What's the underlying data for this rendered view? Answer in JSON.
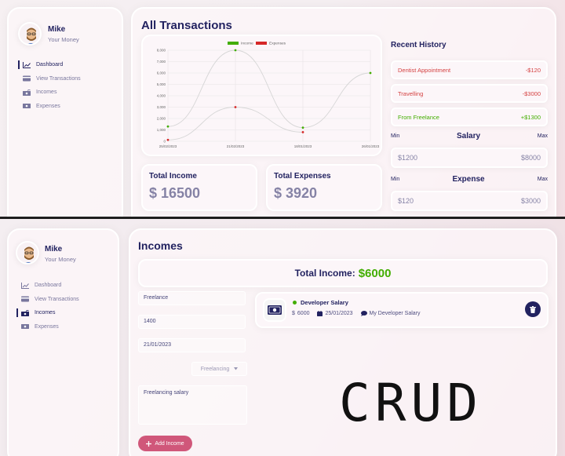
{
  "user": {
    "name": "Mike",
    "subtitle": "Your Money"
  },
  "top": {
    "nav": [
      {
        "label": "Dashboard",
        "icon": "chart-line-icon",
        "active": true
      },
      {
        "label": "View Transactions",
        "icon": "credit-card-icon",
        "active": false
      },
      {
        "label": "Incomes",
        "icon": "money-bill-trend-icon",
        "active": false
      },
      {
        "label": "Expenses",
        "icon": "money-bill-down-icon",
        "active": false
      }
    ],
    "title": "All Transactions",
    "total_income_label": "Total Income",
    "total_income_value": "$ 16500",
    "total_expenses_label": "Total Expenses",
    "total_expenses_value": "$ 3920",
    "recent_history_title": "Recent History",
    "history": [
      {
        "label": "Dentist Appointment",
        "amount": "-$120",
        "type": "expense"
      },
      {
        "label": "Travelling",
        "amount": "-$3000",
        "type": "expense"
      },
      {
        "label": "From Freelance",
        "amount": "+$1300",
        "type": "income"
      }
    ],
    "salary": {
      "title": "Salary",
      "min_label": "Min",
      "max_label": "Max",
      "min": "$1200",
      "max": "$8000"
    },
    "expense": {
      "title": "Expense",
      "min_label": "Min",
      "max_label": "Max",
      "min": "$120",
      "max": "$3000"
    }
  },
  "chart_data": {
    "type": "line",
    "categories": [
      "25/02/2023",
      "21/02/2023",
      "18/01/2023",
      "26/01/2023"
    ],
    "series": [
      {
        "name": "Income",
        "color": "#42ad00",
        "values": [
          1300,
          8000,
          1200,
          6000
        ]
      },
      {
        "name": "Expenses",
        "color": "#d62828",
        "values": [
          120,
          3000,
          800,
          null
        ]
      }
    ],
    "yticks": [
      "0",
      "1,000",
      "2,000",
      "3,000",
      "4,000",
      "5,000",
      "6,000",
      "7,000",
      "8,000"
    ],
    "ylim": [
      0,
      8000
    ],
    "legend": "top-center",
    "grid": true
  },
  "bottom": {
    "nav": [
      {
        "label": "Dashboard",
        "icon": "chart-line-icon",
        "active": false
      },
      {
        "label": "View Transactions",
        "icon": "credit-card-icon",
        "active": false
      },
      {
        "label": "Incomes",
        "icon": "money-bill-trend-icon",
        "active": true
      },
      {
        "label": "Expenses",
        "icon": "money-bill-down-icon",
        "active": false
      }
    ],
    "title": "Incomes",
    "total_label": "Total Income:",
    "total_value": "$6000",
    "form": {
      "title": "Freelance",
      "amount": "1400",
      "date": "21/01/2023",
      "category": "Freelancing",
      "description": "Freelancing salary",
      "button": "Add Income",
      "button_icon": "plus-icon"
    },
    "income_item": {
      "title": "Developer Salary",
      "amount": "6000",
      "date": "25/01/2023",
      "description": "My Developer Salary"
    }
  },
  "overlay_text": "CRUD"
}
